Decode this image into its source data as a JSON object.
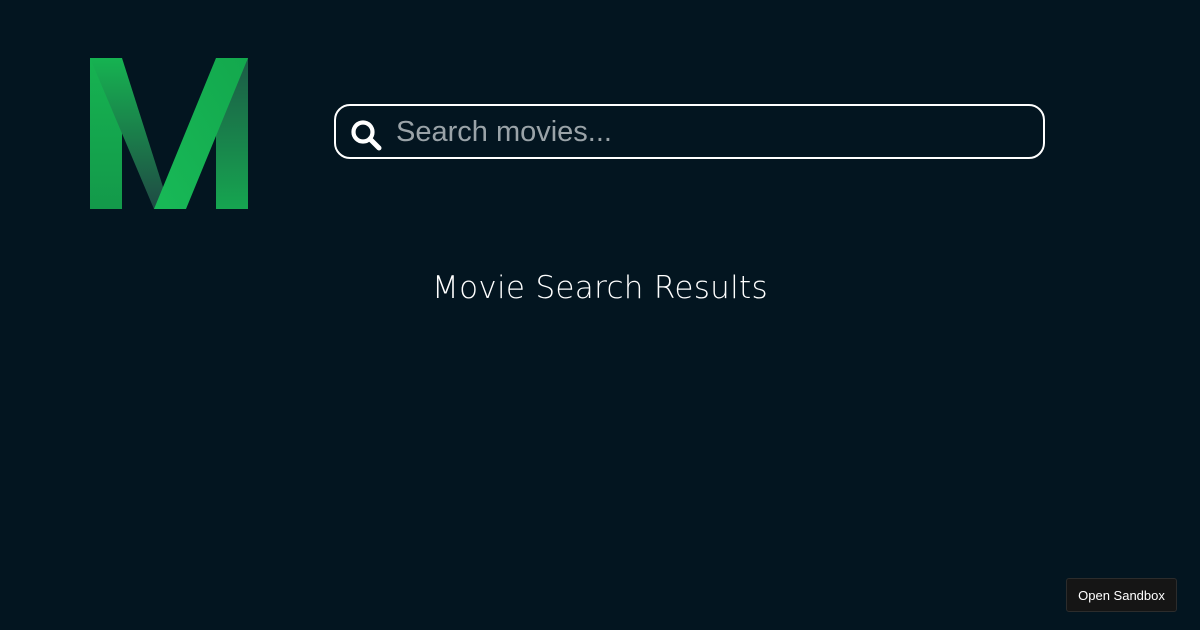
{
  "app": {
    "logo_icon": "m-logo-icon"
  },
  "colors": {
    "background": "#031520",
    "brand_green": "#16b351",
    "brand_green_dark": "#1d5a4a"
  },
  "search": {
    "icon": "search-icon",
    "placeholder": "Search movies...",
    "value": ""
  },
  "main": {
    "title": "Movie Search Results"
  },
  "footer": {
    "sandbox_label": "Open Sandbox"
  }
}
